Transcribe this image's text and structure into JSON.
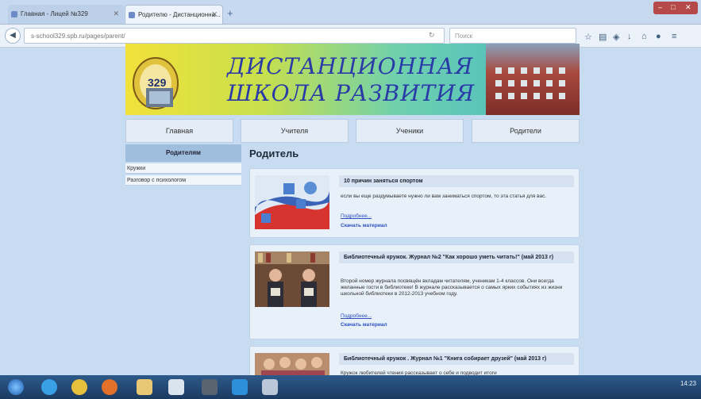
{
  "browser": {
    "tabs": [
      {
        "label": "Главная - Лицей №329"
      },
      {
        "label": "Родителю - Дистанционна..."
      }
    ],
    "new_tab": "+",
    "url": "s-school329.spb.ru/pages/parent/",
    "search_placeholder": "Поиск"
  },
  "banner": {
    "logo_number": "329",
    "title_line1": "ДИСТАНЦИОННАЯ",
    "title_line2": "ШКОЛА РАЗВИТИЯ"
  },
  "nav": {
    "items": [
      {
        "label": "Главная"
      },
      {
        "label": "Учителя"
      },
      {
        "label": "Ученики"
      },
      {
        "label": "Родители"
      }
    ]
  },
  "sidebar": {
    "heading": "Родителям",
    "items": [
      {
        "label": "Кружки"
      },
      {
        "label": "Разговор с психологом"
      }
    ]
  },
  "main": {
    "title": "Родитель",
    "cards": [
      {
        "title": "10 причин заняться спортом",
        "description": "если вы еще раздумываете нужно ли вам заниматься спортом, то эта статья для вас.",
        "more": "Подробнее...",
        "download": "Скачать материал"
      },
      {
        "title": "Библиотечный кружок. Журнал №2 \"Как хорошо уметь читать!\" (май 2013 г)",
        "description": "Второй номер журнала посвящён вкладам читателям, ученикам 1-4 классов. Они всегда желанные гости в библиотеке! В журнале рассказывается о самых ярких событиях из жизни школьной библиотеки в 2012-2013 учебном году.",
        "more": "Подробнее...",
        "download": "Скачать материал"
      },
      {
        "title": "Библиотечный кружок . Журнал №1 \"Книга собирает друзей\" (май 2013 г)",
        "description": "Кружок любителей чтения рассказывает о себе и подводит итоги"
      }
    ]
  },
  "taskbar": {
    "time": "14:23"
  }
}
